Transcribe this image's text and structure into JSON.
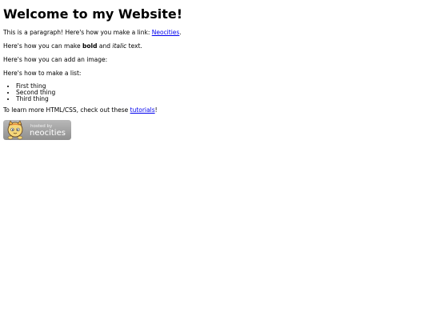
{
  "page": {
    "heading": "Welcome to my Website!",
    "para1": {
      "text": "This is a paragraph! Here's how you make a link: ",
      "link": "Neocities",
      "end": "."
    },
    "para2": {
      "a": "Here's how you can make ",
      "bold": "bold",
      "b": " and ",
      "italic": "italic",
      "c": " text."
    },
    "para3": "Here's how you can add an image:",
    "para4": "Here's how to make a list:",
    "list": [
      "First thing",
      "Second thing",
      "Third thing"
    ],
    "para5": {
      "text": "To learn more HTML/CSS, check out these ",
      "link": "tutorials",
      "end": "!"
    },
    "badge": {
      "line1": "hosted by",
      "line2": "neocities",
      "icon": "neocities-cat-icon"
    }
  }
}
